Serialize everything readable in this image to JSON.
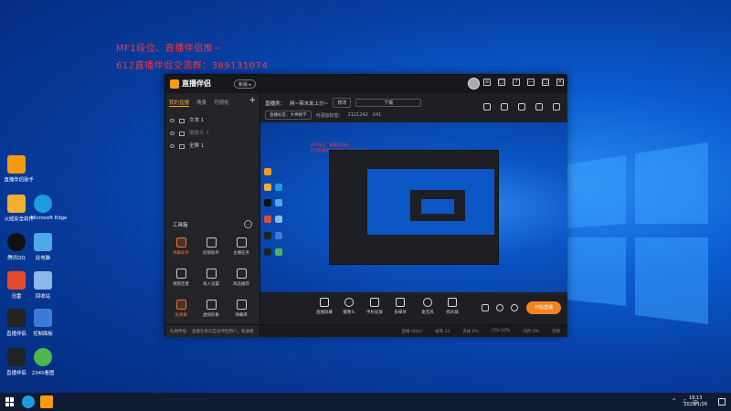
{
  "desktop": {
    "overlay_line1": "MF1段位、直播伴侣推~",
    "overlay_line2": "612直播伴侣交流群：389131074",
    "icons": [
      {
        "label": "直播伴侣助手",
        "color": "#f39c12"
      },
      {
        "label": "火绒安全软件",
        "color": "#f0b030"
      },
      {
        "label": "Microsoft Edge",
        "color": "#1e9be0"
      },
      {
        "label": "腾讯QQ",
        "color": "#111111"
      },
      {
        "label": "此电脑",
        "color": "#4fa8e8"
      },
      {
        "label": "迅雷",
        "color": "#e64a2e"
      },
      {
        "label": "回收站",
        "color": "#8ab8e8"
      },
      {
        "label": "直播伴侣",
        "color": "#222222"
      },
      {
        "label": "控制面板",
        "color": "#3c7ad8"
      },
      {
        "label": "直播伴侣",
        "color": "#222222"
      },
      {
        "label": "2345看图",
        "color": "#4cb84c"
      }
    ]
  },
  "app": {
    "logo_text": "直播伴侣",
    "badge": "新版 ▸",
    "title_icons": [
      "≡",
      "□",
      "?",
      "—",
      "□",
      "✕"
    ],
    "left_tabs": [
      "我的直播",
      "场景",
      "可视化"
    ],
    "sources": [
      {
        "label": "文本 1"
      },
      {
        "label": "摄像头 1"
      },
      {
        "label": "全屏 1"
      }
    ],
    "tools_title": "工具箱",
    "tools": [
      {
        "label": "弹幕助手",
        "hot": true
      },
      {
        "label": "房管助手",
        "hot": false
      },
      {
        "label": "主播任务",
        "hot": false
      },
      {
        "label": "视频连麦",
        "hot": false
      },
      {
        "label": "录入设置",
        "hot": false
      },
      {
        "label": "商品推荐",
        "hot": false
      },
      {
        "label": "送弹幕",
        "hot": true
      },
      {
        "label": "虚拟形象",
        "hot": false
      },
      {
        "label": "弹幕库",
        "hot": false
      }
    ],
    "left_footer": "礼物伴侣　 直播礼物与互动伴侣用户，联通哦",
    "topbar": {
      "label_prefix": "直播类：",
      "category": "网~带水友上分~",
      "edit_tag": "修改",
      "game": "下载",
      "row2_tag": "直播标签：大神教学",
      "row2_text1": "可添加标签：",
      "row2_num": "2121242",
      "row2_count": "241"
    },
    "bottom_bar": [
      {
        "label": "直播屏幕"
      },
      {
        "label": "摄像头"
      },
      {
        "label": "手机投屏"
      },
      {
        "label": "多媒体"
      },
      {
        "label": "麦克风"
      },
      {
        "label": "扬声器"
      }
    ],
    "go_live": "开始直播",
    "status": [
      "直播 0kb/s",
      "帧率 33",
      "丢帧 0%",
      "CPU 10%",
      "内存 0%",
      "流畅"
    ]
  },
  "taskbar": {
    "time": "18:13",
    "date": "2022/1/26",
    "tray": [
      "^",
      "♪",
      "中"
    ]
  }
}
